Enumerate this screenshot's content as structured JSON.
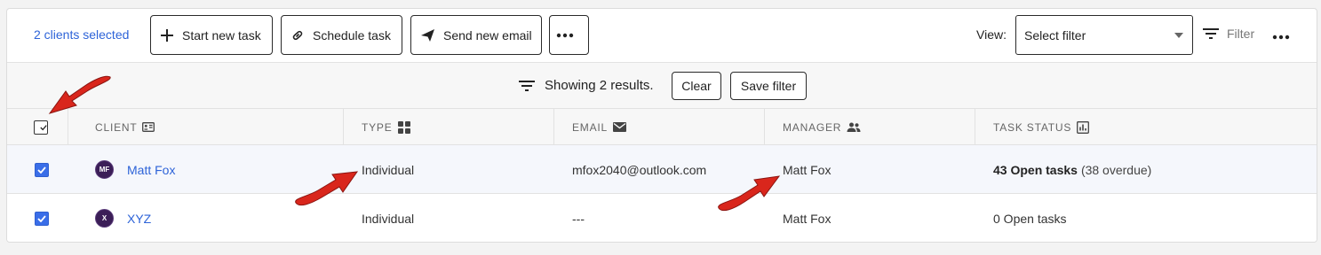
{
  "toolbar": {
    "selected_count": "2 clients selected",
    "start_task": "Start new task",
    "schedule_task": "Schedule task",
    "send_email": "Send new email",
    "view_label": "View:",
    "view_select": "Select filter",
    "filter_label": "Filter"
  },
  "filterbar": {
    "showing": "Showing 2 results.",
    "clear": "Clear",
    "save_filter": "Save filter"
  },
  "columns": {
    "client": "CLIENT",
    "type": "TYPE",
    "email": "EMAIL",
    "manager": "MANAGER",
    "task_status": "TASK STATUS"
  },
  "rows": [
    {
      "initials": "MF",
      "client": "Matt Fox",
      "type": "Individual",
      "email": "mfox2040@outlook.com",
      "manager": "Matt Fox",
      "tasks": "43 Open tasks",
      "overdue": "(38 overdue)"
    },
    {
      "initials": "X",
      "client": "XYZ",
      "type": "Individual",
      "email": "---",
      "manager": "Matt Fox",
      "tasks": "0 Open tasks",
      "overdue": ""
    }
  ],
  "colors": {
    "accent": "#2d63d8",
    "checkbox": "#3a6ee8",
    "avatar": "#3b1e57",
    "annotation_arrow": "#d9261c"
  },
  "icons": [
    "plus-icon",
    "link-icon",
    "send-icon",
    "more-icon",
    "filter-icon",
    "id-card-icon",
    "grid-icon",
    "mail-icon",
    "people-icon",
    "bar-chart-icon",
    "check-icon",
    "annotation-arrow"
  ]
}
